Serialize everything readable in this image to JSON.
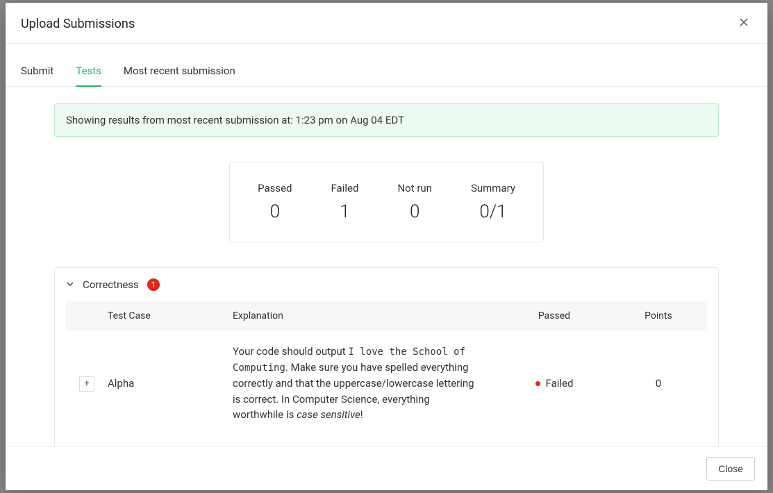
{
  "header": {
    "title": "Upload Submissions"
  },
  "tabs": {
    "submit": "Submit",
    "tests": "Tests",
    "recent": "Most recent submission"
  },
  "notice": {
    "text": "Showing results from most recent submission at: 1:23 pm on Aug 04 EDT"
  },
  "stats": {
    "passed_label": "Passed",
    "passed_value": "0",
    "failed_label": "Failed",
    "failed_value": "1",
    "notrun_label": "Not run",
    "notrun_value": "0",
    "summary_label": "Summary",
    "summary_value": "0/1"
  },
  "group": {
    "title": "Correctness",
    "badge": "1",
    "columns": {
      "testcase": "Test Case",
      "explanation": "Explanation",
      "passed": "Passed",
      "points": "Points"
    },
    "row": {
      "expand": "+",
      "name": "Alpha",
      "explanation_pre": "Your code should output ",
      "explanation_code": "I love the School of Computing",
      "explanation_mid": ". Make sure you have spelled everything correctly and that the uppercase/lowercase lettering is correct. In Computer Science, everything worthwhile is ",
      "explanation_italic": "case sensitive",
      "explanation_post": "!",
      "passed": "Failed",
      "points": "0"
    }
  },
  "footer": {
    "close_label": "Close"
  }
}
